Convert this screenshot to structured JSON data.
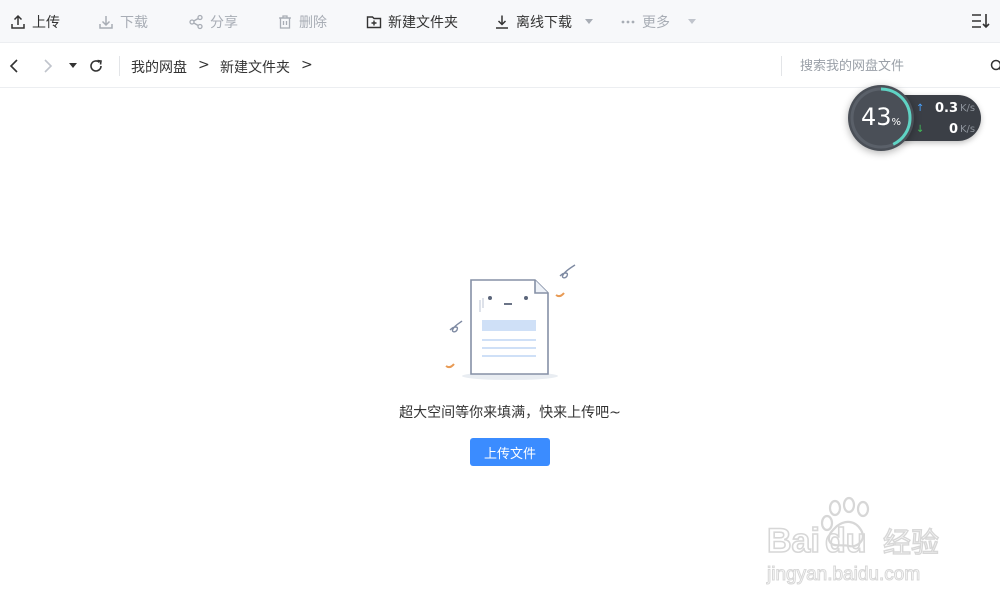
{
  "toolbar": {
    "upload_label": "上传",
    "download_label": "下载",
    "share_label": "分享",
    "delete_label": "删除",
    "new_folder_label": "新建文件夹",
    "offline_download_label": "离线下载",
    "more_label": "更多"
  },
  "nav": {
    "breadcrumbs": [
      "我的网盘",
      "新建文件夹"
    ],
    "separator": ">"
  },
  "search": {
    "placeholder": "搜索我的网盘文件"
  },
  "speed_widget": {
    "percent": "43",
    "percent_unit": "%",
    "upload_speed": "0.3",
    "download_speed": "0",
    "unit": "K/s"
  },
  "empty_state": {
    "message": "超大空间等你来填满，快来上传吧~",
    "upload_button_label": "上传文件"
  },
  "colors": {
    "accent": "#3b8cff",
    "toolbar_bg": "#f7f8fa",
    "widget_bg": "#3b3f46",
    "upload_arrow": "#4aa3ff",
    "download_arrow": "#41c15a",
    "ring": "#5fd3c4"
  },
  "watermark": {
    "brand": "Baidu",
    "cn_text": "经验",
    "url": "jingyan.baidu.com"
  }
}
